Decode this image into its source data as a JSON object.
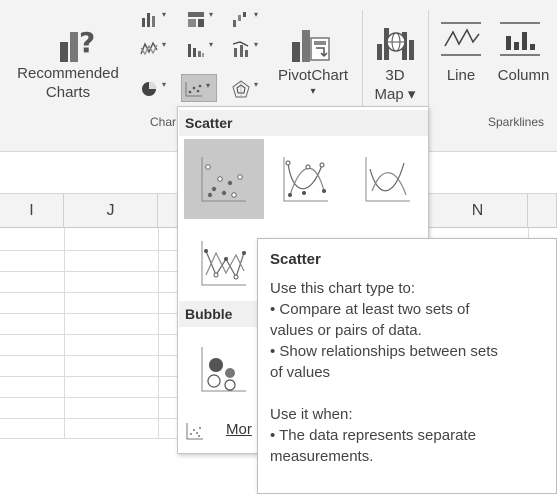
{
  "ribbon": {
    "recommended_line1": "Recommended",
    "recommended_line2": "Charts",
    "charts_group_label": "Char",
    "pivotchart_label": "PivotChart",
    "pivotchart_caret": "▾",
    "map_line1": "3D",
    "map_line2": "Map ▾",
    "line_label": "Line",
    "column_label": "Column",
    "sparklines_label": "Sparklines",
    "small_caret": "▾"
  },
  "columns": {
    "i": "I",
    "j": "J",
    "n": "N"
  },
  "dropdown": {
    "scatter_header": "Scatter",
    "bubble_header": "Bubble",
    "more_label": "Mor"
  },
  "tooltip": {
    "title": "Scatter",
    "intro": "Use this chart type to:",
    "bullet1_line1": "• Compare at least two sets of",
    "bullet1_line2": "values or pairs of data.",
    "bullet2_line1": "• Show relationships between sets",
    "bullet2_line2": "of values",
    "when_heading": "Use it when:",
    "when_bullet_line1": "• The data represents separate",
    "when_bullet_line2": "measurements."
  }
}
